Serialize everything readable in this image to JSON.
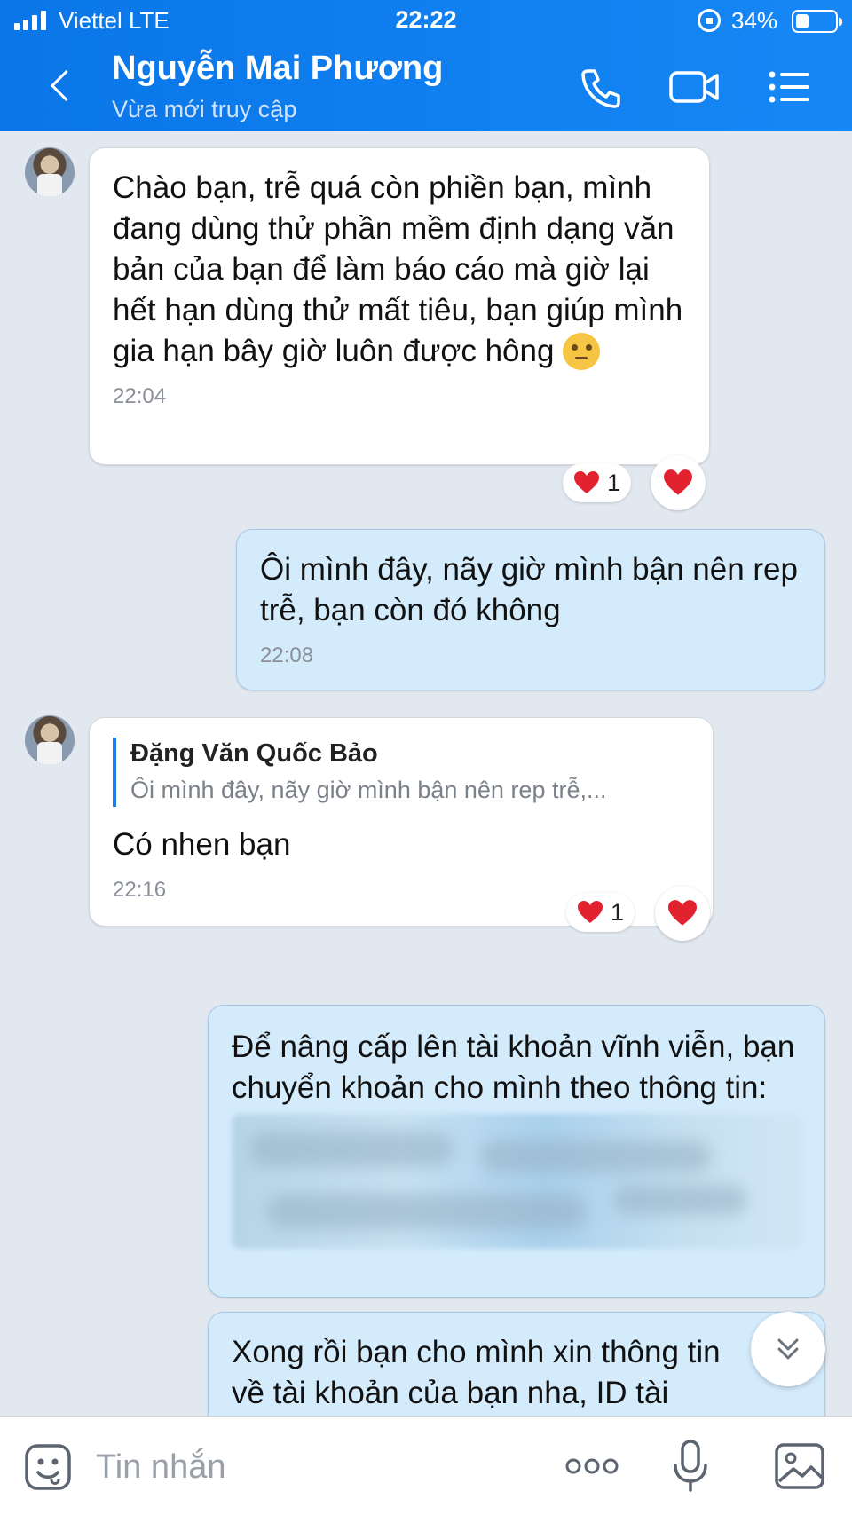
{
  "status_bar": {
    "carrier": "Viettel  LTE",
    "time": "22:22",
    "battery": "34%"
  },
  "header": {
    "contact_name": "Nguyễn Mai Phương",
    "contact_status": "Vừa mới truy cập",
    "icons": [
      "back-icon",
      "phone-icon",
      "video-call-icon",
      "menu-icon"
    ]
  },
  "messages": [
    {
      "direction": "incoming",
      "text": "Chào bạn, trễ quá còn phiền bạn, mình đang dùng thử phần mềm định dạng văn bản của bạn để làm báo cáo mà giờ lại hết hạn dùng thử mất tiêu, bạn giúp mình gia hạn bây giờ luôn được hông",
      "emoji": "thinking-face",
      "time": "22:04",
      "reaction_count": "1"
    },
    {
      "direction": "outgoing",
      "text": "Ôi mình đây, nãy giờ mình bận nên rep trễ, bạn còn đó không",
      "time": "22:08"
    },
    {
      "direction": "incoming",
      "quote_name": "Đặng Văn Quốc Bảo",
      "quote_text": "Ôi mình đây, nãy giờ mình bận nên rep trễ,...",
      "text": "Có nhen bạn",
      "time": "22:16",
      "reaction_count": "1"
    },
    {
      "direction": "outgoing",
      "text": "Để nâng cấp lên tài khoản vĩnh viễn, bạn chuyển khoản cho mình theo thông tin:",
      "blurred_content": true
    },
    {
      "direction": "outgoing",
      "text": "Xong rồi bạn cho mình xin thông tin về tài khoản của bạn nha, ID tài"
    }
  ],
  "input_bar": {
    "placeholder": "Tin nhắn",
    "icons": [
      "sticker-icon",
      "more-options-icon",
      "microphone-icon",
      "image-icon"
    ]
  },
  "colors": {
    "header": "#1687f5",
    "chat_background": "#e2e8f0",
    "outgoing_bubble": "#d4ebfc",
    "incoming_bubble": "#ffffff",
    "reaction_heart": "#e3222f"
  }
}
